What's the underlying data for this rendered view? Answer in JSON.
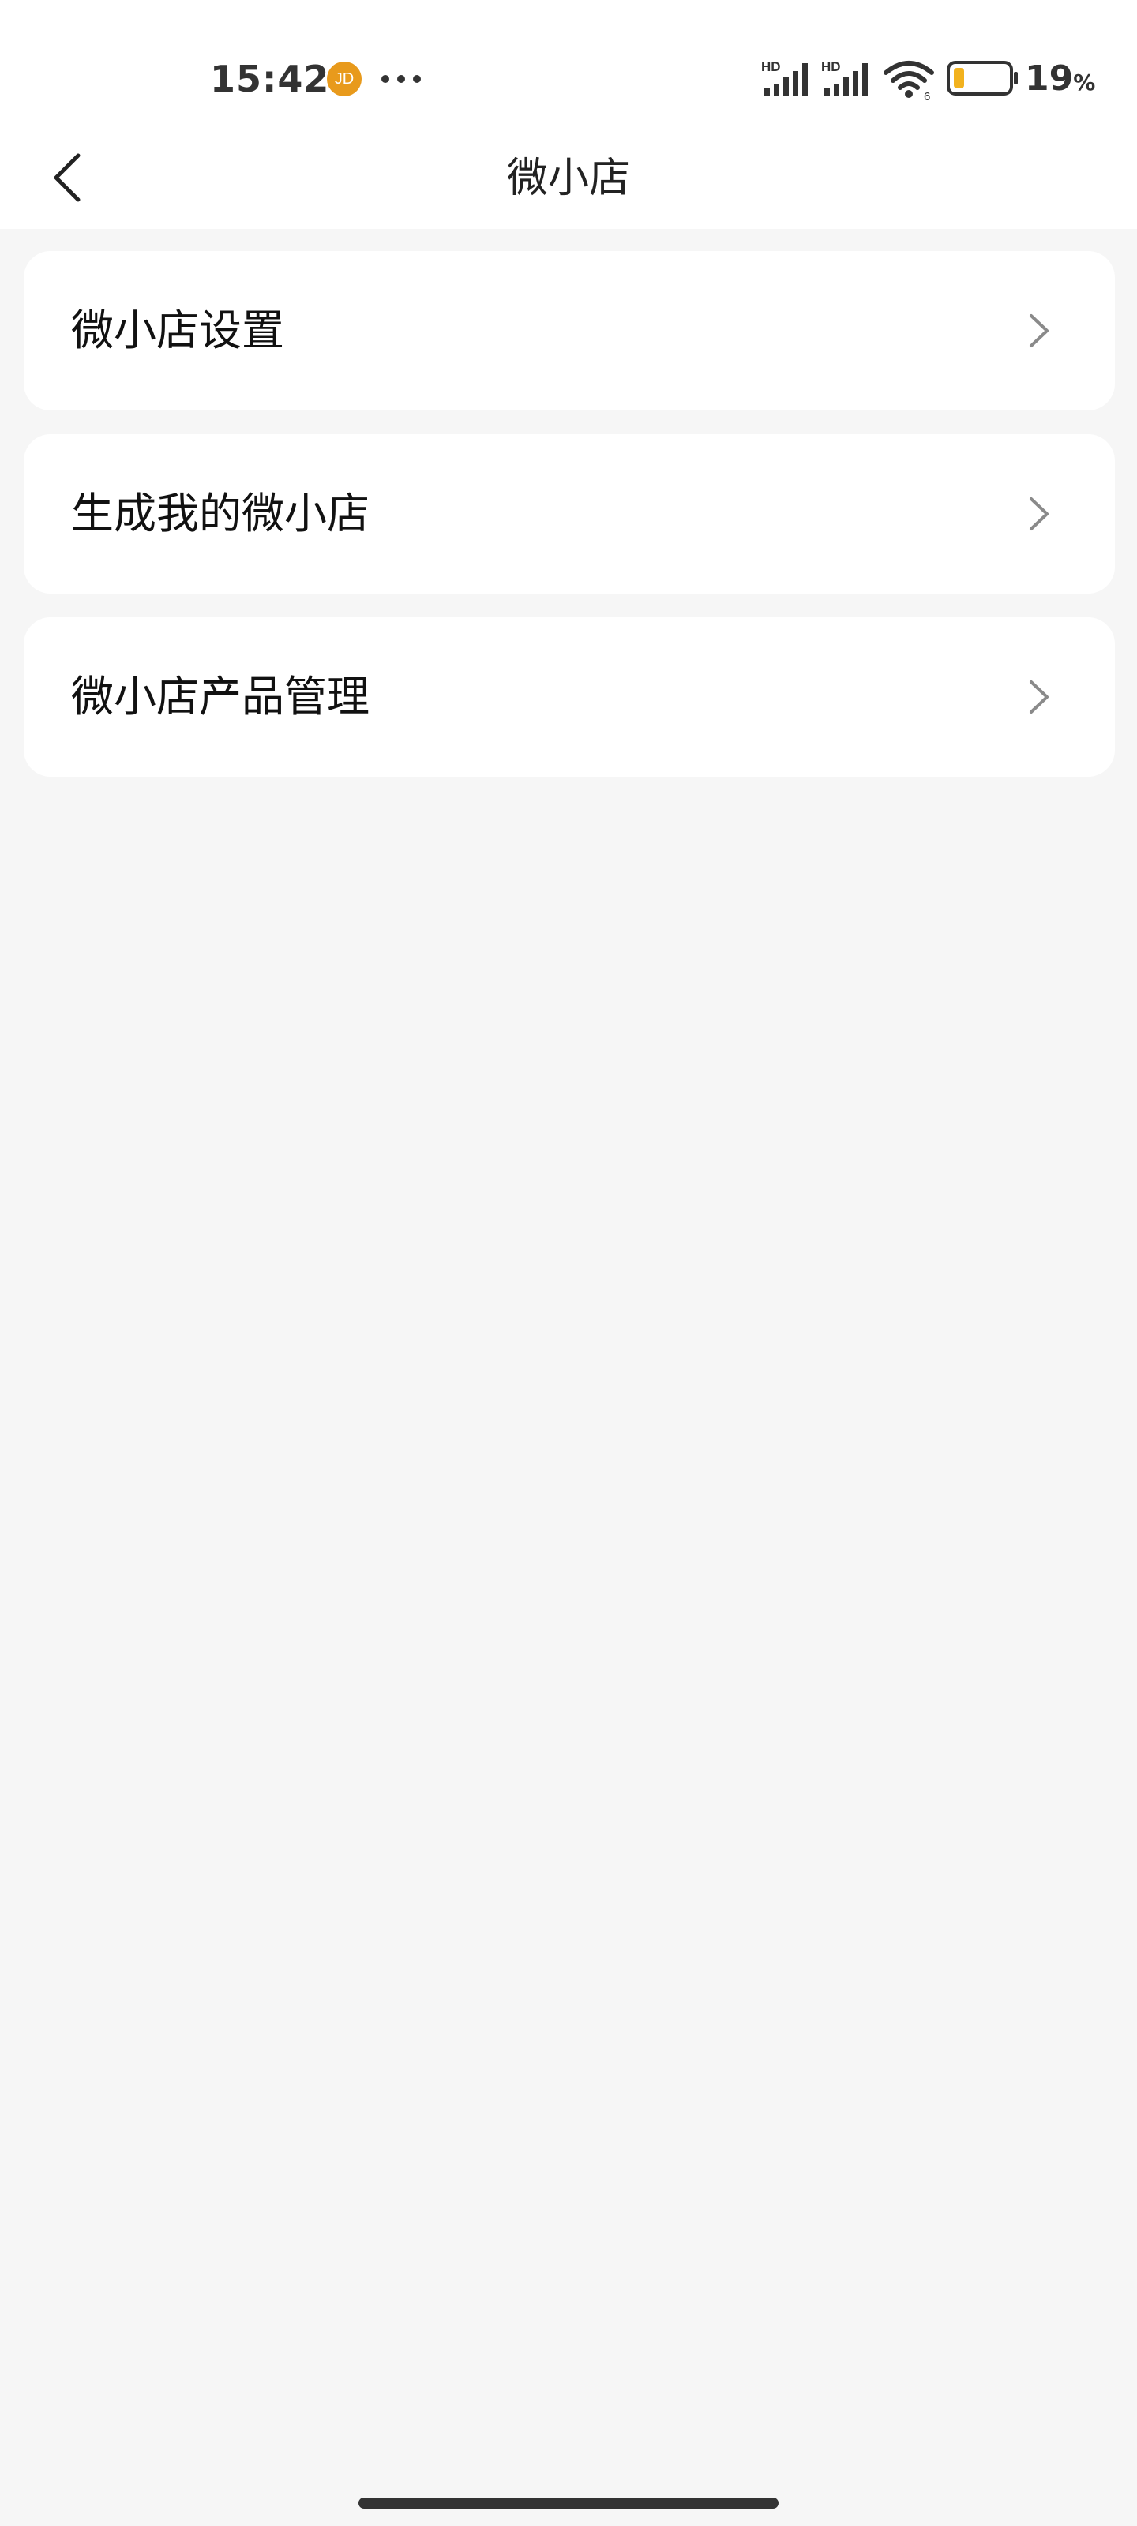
{
  "status_bar": {
    "time": "15:42",
    "notification_badge": "JD",
    "signal1_label": "HD",
    "signal2_label": "HD",
    "wifi_sub": "6",
    "battery_level": "19",
    "battery_unit": "%",
    "battery_fill_fraction": 0.19,
    "colors": {
      "badge": "#e89a1c",
      "battery_fill": "#f2b21e"
    }
  },
  "nav": {
    "back_icon": "chevron-left-icon",
    "title": "微小店"
  },
  "menu": {
    "items": [
      {
        "label": "微小店设置",
        "icon": "chevron-right-icon"
      },
      {
        "label": "生成我的微小店",
        "icon": "chevron-right-icon"
      },
      {
        "label": "微小店产品管理",
        "icon": "chevron-right-icon"
      }
    ]
  }
}
